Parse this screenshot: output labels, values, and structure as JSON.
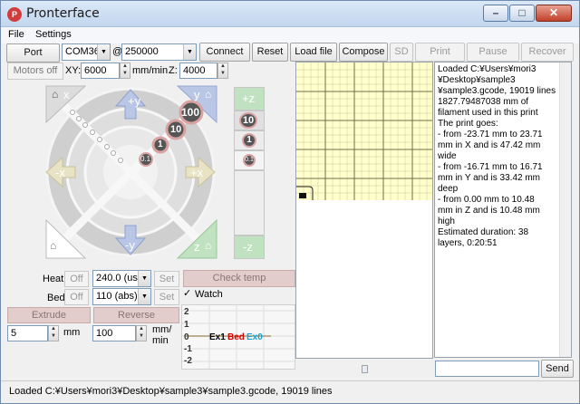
{
  "window": {
    "title": "Pronterface",
    "icon_text": "P"
  },
  "caption": {
    "minimize": "–",
    "maximize": "□",
    "close": "✕"
  },
  "menu": [
    "File",
    "Settings"
  ],
  "toolbar": {
    "port_label": "Port",
    "port_value": "COM36",
    "at_symbol": "@",
    "baud_value": "250000",
    "connect": "Connect",
    "reset": "Reset",
    "load_file": "Load file",
    "compose": "Compose",
    "sd": "SD",
    "print": "Print",
    "pause": "Pause",
    "recover": "Recover"
  },
  "motion": {
    "motors_off": "Motors off",
    "xy_label": "XY:",
    "xy_value": "6000",
    "xy_unit": "mm/min",
    "z_label": "Z:",
    "z_value": "4000"
  },
  "jog": {
    "y_plus": "+y",
    "y_minus": "-y",
    "x_plus": "+x",
    "x_minus": "-x",
    "home_x": "x",
    "home_y": "y",
    "home_z": "z",
    "steps": [
      "100",
      "10",
      "1",
      "0.1"
    ],
    "z_plus": "+z",
    "z_minus": "-z",
    "z_steps": [
      "10",
      "1",
      "0.1"
    ]
  },
  "temps": {
    "heat_label": "Heat:",
    "bed_label": "Bed:",
    "off": "Off",
    "heat_value": "240.0 (us",
    "bed_value": "110 (abs)",
    "set": "Set",
    "check_temp": "Check temp",
    "watch": "Watch",
    "watch_checked": true
  },
  "extrude": {
    "extrude_label": "Extrude",
    "reverse_label": "Reverse",
    "amount": "5",
    "amount_unit": "mm",
    "speed": "100",
    "speed_unit_1": "mm/",
    "speed_unit_2": "min"
  },
  "graph": {
    "y_ticks": [
      "2",
      "1",
      "0",
      "-1",
      "-2"
    ],
    "legend": [
      {
        "text": "Ex1",
        "color": "#000000"
      },
      {
        "text": "Bed",
        "color": "#d40000"
      },
      {
        "text": "Ex0",
        "color": "#1aa0d8"
      }
    ]
  },
  "log": [
    "Loaded C:¥Users¥mori3",
    "¥Desktop¥sample3",
    "¥sample3.gcode, 19019 lines",
    "1827.79487038 mm of",
    "filament used in this print",
    " The print goes:",
    "- from -23.71 mm to 23.71",
    "mm in X and is 47.42 mm",
    "wide",
    "- from -16.71 mm to 16.71",
    "mm in Y and is 33.42 mm",
    "deep",
    "- from 0.00 mm to 10.48",
    "mm in Z and is 10.48 mm",
    "high",
    "Estimated duration: 38",
    "layers, 0:20:51"
  ],
  "send": {
    "label": "Send",
    "value": ""
  },
  "statusbar": "Loaded C:¥Users¥mori3¥Desktop¥sample3¥sample3.gcode, 19019 lines",
  "colors": {
    "grid_bg": "#ffffcc",
    "grid_line": "#9a9a6a",
    "jog_y": "#b9c6e6",
    "jog_x": "#e7e3c4",
    "jog_z": "#c1e2c1",
    "step_pink": "#d8a2a2"
  }
}
